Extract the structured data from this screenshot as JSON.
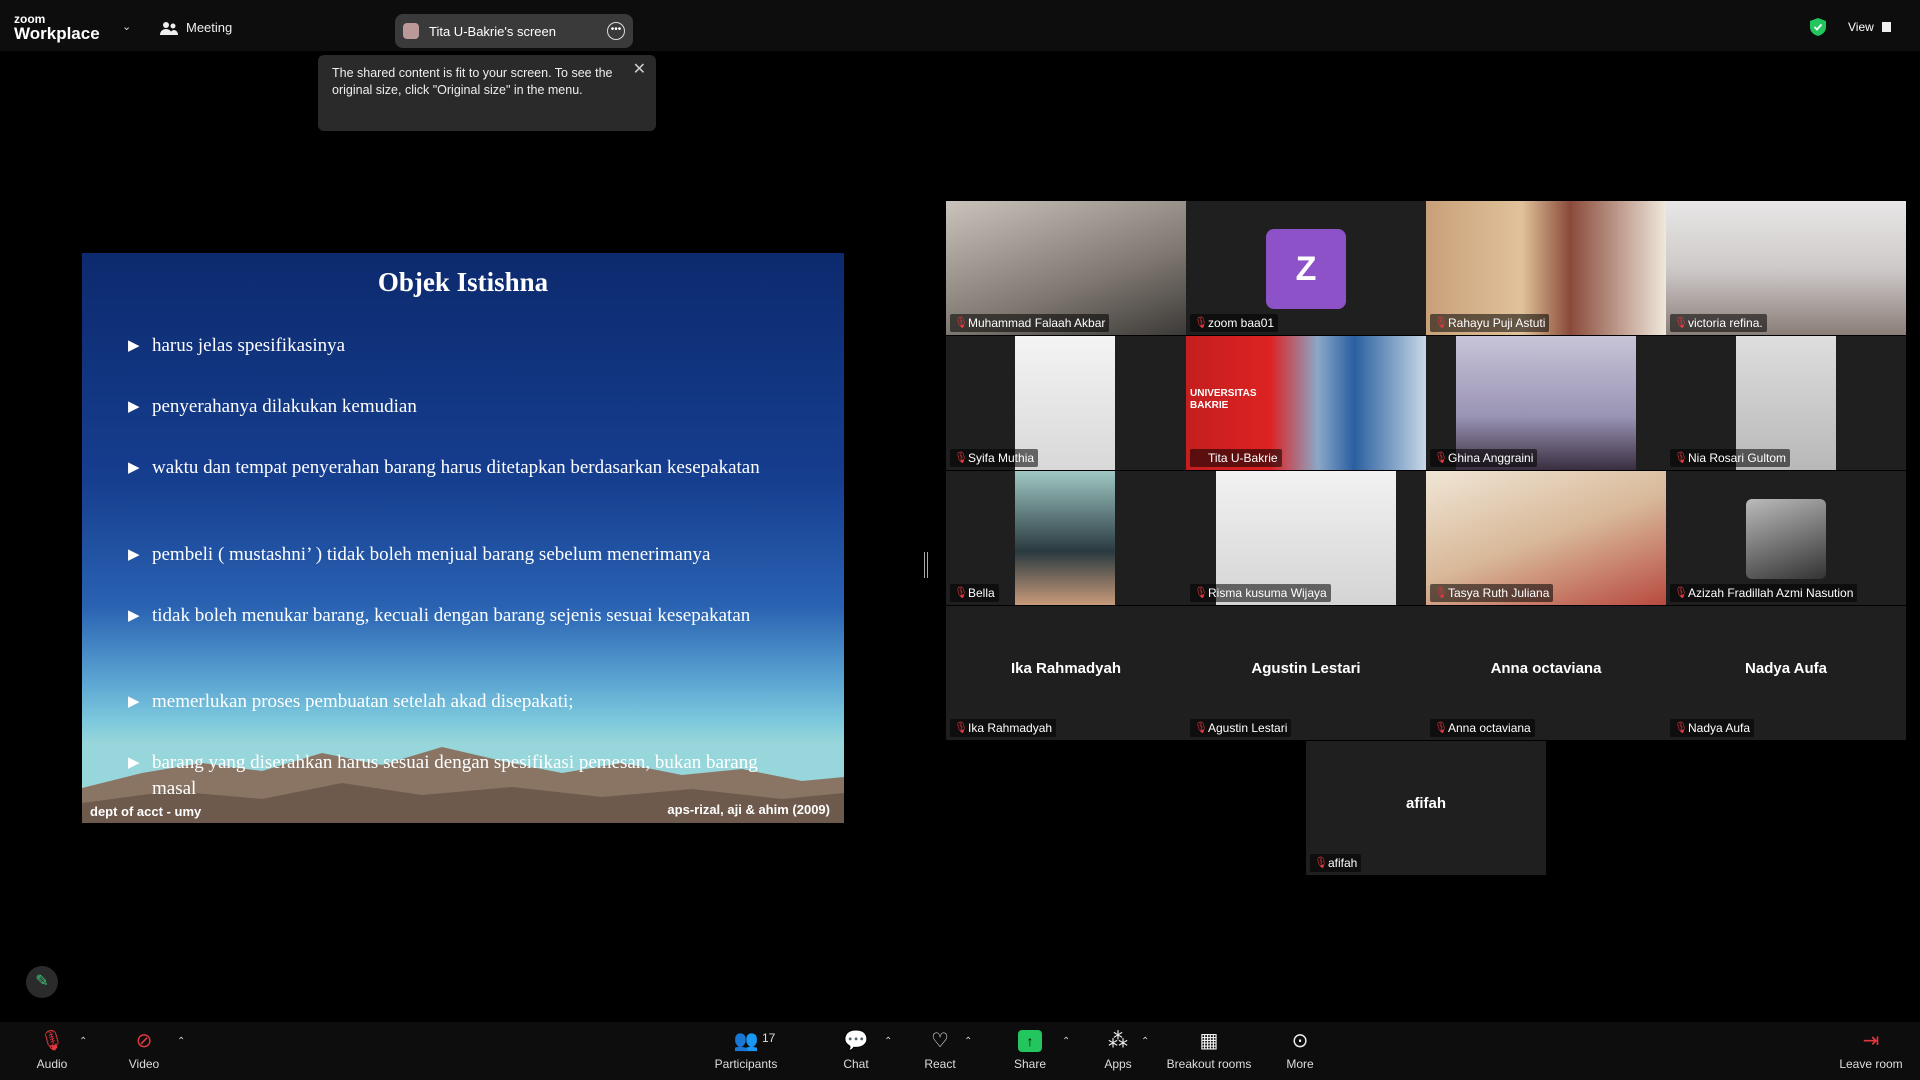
{
  "app": {
    "logo_small": "zoom",
    "logo_big": "Workplace",
    "meeting_label": "Meeting",
    "screen_share_label": "Tita U-Bakrie's screen",
    "view_label": "View"
  },
  "tooltip": {
    "text": "The shared content is fit to your screen. To see the original size, click \"Original size\" in the menu."
  },
  "slide": {
    "title": "Objek Istishna",
    "bullets": [
      "harus jelas spesifikasinya",
      "penyerahanya dilakukan kemudian",
      "waktu dan tempat penyerahan barang harus ditetapkan berdasarkan kesepakatan",
      "pembeli ( mustashni’ ) tidak boleh menjual barang sebelum menerimanya",
      "tidak boleh menukar barang, kecuali dengan barang sejenis sesuai kesepakatan",
      "memerlukan proses pembuatan setelah akad disepakati;",
      "barang yang diserahkan harus sesuai dengan spesifikasi pemesan, bukan barang masal"
    ],
    "footer_left": "dept of acct - umy",
    "footer_right": "aps-rizal, aji & ahim (2009)"
  },
  "participants": [
    {
      "name": "Muhammad Falaah Akbar"
    },
    {
      "name": "zoom baa01",
      "avatar_letter": "Z"
    },
    {
      "name": "Rahayu Puji Astuti"
    },
    {
      "name": "victoria refina."
    },
    {
      "name": "Syifa Muthia"
    },
    {
      "name": "Tita U-Bakrie",
      "banner": "UNIVERSITAS BAKRIE"
    },
    {
      "name": "Ghina Anggraini"
    },
    {
      "name": "Nia Rosari Gultom"
    },
    {
      "name": "Bella"
    },
    {
      "name": "Risma kusuma Wijaya"
    },
    {
      "name": "Tasya Ruth Juliana"
    },
    {
      "name": "Azizah Fradillah Azmi Nasution"
    },
    {
      "name": "Ika Rahmadyah",
      "display": "Ika Rahmadyah"
    },
    {
      "name": "Agustin Lestari",
      "display": "Agustin Lestari"
    },
    {
      "name": "Anna octaviana",
      "display": "Anna octaviana"
    },
    {
      "name": "Nadya Aufa",
      "display": "Nadya Aufa"
    },
    {
      "name": "afifah",
      "display": "afifah"
    }
  ],
  "toolbar": {
    "audio": "Audio",
    "video": "Video",
    "participants": "Participants",
    "participants_count": "17",
    "chat": "Chat",
    "react": "React",
    "share": "Share",
    "apps": "Apps",
    "breakout": "Breakout rooms",
    "more": "More",
    "leave": "Leave room"
  },
  "colors": {
    "active_speaker": "#37c66b",
    "muted_mic": "#e0383e",
    "share_button": "#22c55e",
    "avatar_bg": "#8d52c8"
  }
}
